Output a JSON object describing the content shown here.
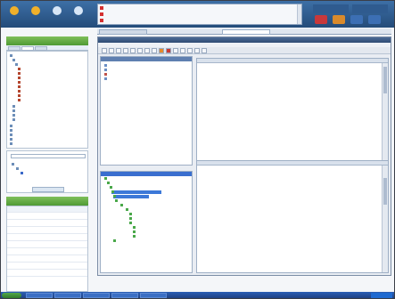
{
  "toolbar": {
    "buttons": [
      {
        "label": "",
        "icon": "home-icon",
        "color": "#f0b02a"
      },
      {
        "label": "",
        "icon": "topology-icon",
        "color": "#f0b02a"
      },
      {
        "label": "",
        "icon": "config-icon",
        "color": "#d7e6f7"
      },
      {
        "label": "",
        "icon": "fault-icon",
        "color": "#d7e6f7"
      },
      {
        "label": "",
        "icon": "report-icon",
        "color": "#d7e6f7"
      }
    ]
  },
  "alarms": [
    {
      "c1": "",
      "c2": "",
      "c3": ""
    },
    {
      "c1": "",
      "c2": "",
      "c3": ""
    },
    {
      "c1": "",
      "c2": "",
      "c3": ""
    }
  ],
  "left_panel": {
    "title": "",
    "tabs": [
      "",
      "",
      ""
    ],
    "tree": [
      "",
      "",
      "",
      "",
      "",
      "",
      "",
      "",
      "",
      "",
      "",
      "",
      "",
      "",
      "",
      "",
      "",
      "",
      "",
      "",
      ""
    ],
    "find_placeholder": "",
    "find_button": "",
    "favorites_title": "",
    "favorites": [
      {
        "c1": "",
        "c2": ""
      },
      {
        "c1": "",
        "c2": ""
      },
      {
        "c1": "",
        "c2": ""
      },
      {
        "c1": "",
        "c2": ""
      },
      {
        "c1": "",
        "c2": ""
      },
      {
        "c1": "",
        "c2": ""
      },
      {
        "c1": "",
        "c2": ""
      },
      {
        "c1": "",
        "c2": ""
      },
      {
        "c1": "",
        "c2": ""
      },
      {
        "c1": "",
        "c2": ""
      }
    ]
  },
  "main_tabs": [
    "",
    ""
  ],
  "inner": {
    "title": "",
    "menu": [
      "",
      "",
      "",
      ""
    ],
    "items": [
      "",
      "",
      "",
      ""
    ],
    "tree": [
      "",
      "",
      "",
      "",
      "",
      "",
      "",
      "",
      "",
      "",
      "",
      "",
      "",
      "",
      ""
    ],
    "table1": [],
    "table2": []
  },
  "taskbar": {
    "start": "",
    "items": [
      "",
      "",
      "",
      "",
      ""
    ],
    "clock": ""
  }
}
